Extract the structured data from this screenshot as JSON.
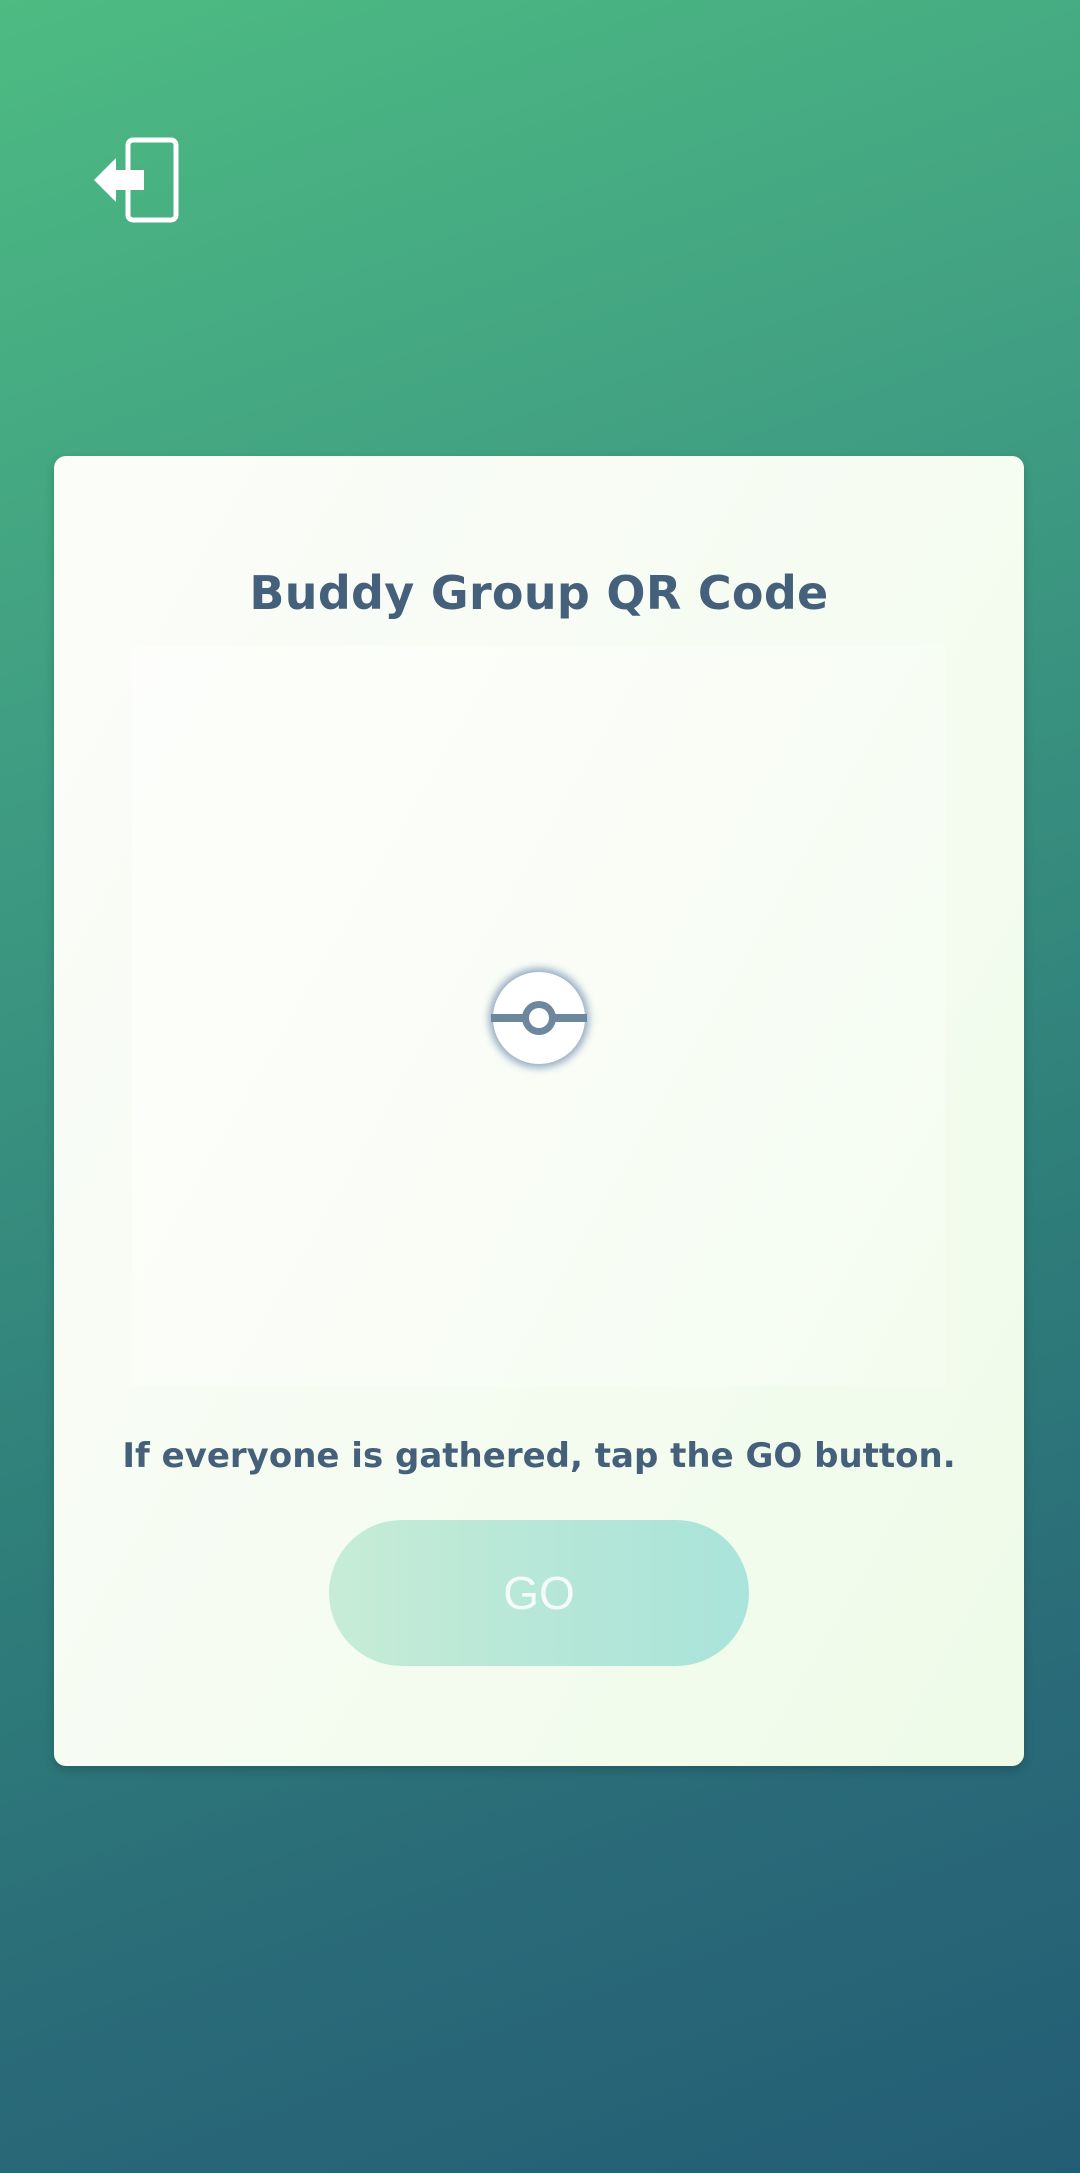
{
  "header": {
    "exit_icon": "exit-door-icon"
  },
  "card": {
    "title": "Buddy Group QR Code",
    "loading_icon": "pokeball-loading-icon",
    "instruction": "If everyone is gathered, tap the GO button.",
    "go_label": "GO"
  },
  "colors": {
    "background_top": "#4dbb82",
    "background_bottom": "#235d75",
    "text": "#44607a",
    "go_button": "#b4e6d8"
  }
}
